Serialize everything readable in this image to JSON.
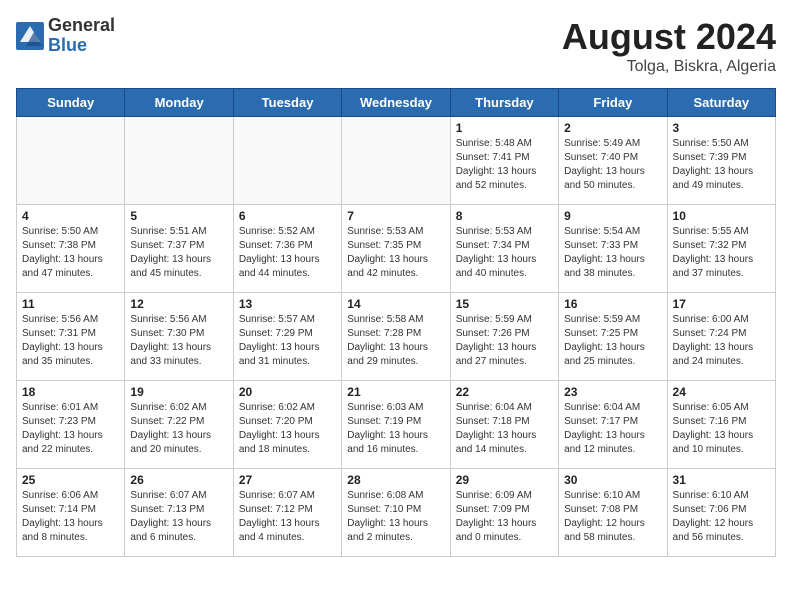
{
  "logo": {
    "general": "General",
    "blue": "Blue"
  },
  "title": {
    "month_year": "August 2024",
    "location": "Tolga, Biskra, Algeria"
  },
  "weekdays": [
    "Sunday",
    "Monday",
    "Tuesday",
    "Wednesday",
    "Thursday",
    "Friday",
    "Saturday"
  ],
  "weeks": [
    [
      {
        "day": "",
        "empty": true
      },
      {
        "day": "",
        "empty": true
      },
      {
        "day": "",
        "empty": true
      },
      {
        "day": "",
        "empty": true
      },
      {
        "day": "1",
        "info": "Sunrise: 5:48 AM\nSunset: 7:41 PM\nDaylight: 13 hours\nand 52 minutes."
      },
      {
        "day": "2",
        "info": "Sunrise: 5:49 AM\nSunset: 7:40 PM\nDaylight: 13 hours\nand 50 minutes."
      },
      {
        "day": "3",
        "info": "Sunrise: 5:50 AM\nSunset: 7:39 PM\nDaylight: 13 hours\nand 49 minutes."
      }
    ],
    [
      {
        "day": "4",
        "info": "Sunrise: 5:50 AM\nSunset: 7:38 PM\nDaylight: 13 hours\nand 47 minutes."
      },
      {
        "day": "5",
        "info": "Sunrise: 5:51 AM\nSunset: 7:37 PM\nDaylight: 13 hours\nand 45 minutes."
      },
      {
        "day": "6",
        "info": "Sunrise: 5:52 AM\nSunset: 7:36 PM\nDaylight: 13 hours\nand 44 minutes."
      },
      {
        "day": "7",
        "info": "Sunrise: 5:53 AM\nSunset: 7:35 PM\nDaylight: 13 hours\nand 42 minutes."
      },
      {
        "day": "8",
        "info": "Sunrise: 5:53 AM\nSunset: 7:34 PM\nDaylight: 13 hours\nand 40 minutes."
      },
      {
        "day": "9",
        "info": "Sunrise: 5:54 AM\nSunset: 7:33 PM\nDaylight: 13 hours\nand 38 minutes."
      },
      {
        "day": "10",
        "info": "Sunrise: 5:55 AM\nSunset: 7:32 PM\nDaylight: 13 hours\nand 37 minutes."
      }
    ],
    [
      {
        "day": "11",
        "info": "Sunrise: 5:56 AM\nSunset: 7:31 PM\nDaylight: 13 hours\nand 35 minutes."
      },
      {
        "day": "12",
        "info": "Sunrise: 5:56 AM\nSunset: 7:30 PM\nDaylight: 13 hours\nand 33 minutes."
      },
      {
        "day": "13",
        "info": "Sunrise: 5:57 AM\nSunset: 7:29 PM\nDaylight: 13 hours\nand 31 minutes."
      },
      {
        "day": "14",
        "info": "Sunrise: 5:58 AM\nSunset: 7:28 PM\nDaylight: 13 hours\nand 29 minutes."
      },
      {
        "day": "15",
        "info": "Sunrise: 5:59 AM\nSunset: 7:26 PM\nDaylight: 13 hours\nand 27 minutes."
      },
      {
        "day": "16",
        "info": "Sunrise: 5:59 AM\nSunset: 7:25 PM\nDaylight: 13 hours\nand 25 minutes."
      },
      {
        "day": "17",
        "info": "Sunrise: 6:00 AM\nSunset: 7:24 PM\nDaylight: 13 hours\nand 24 minutes."
      }
    ],
    [
      {
        "day": "18",
        "info": "Sunrise: 6:01 AM\nSunset: 7:23 PM\nDaylight: 13 hours\nand 22 minutes."
      },
      {
        "day": "19",
        "info": "Sunrise: 6:02 AM\nSunset: 7:22 PM\nDaylight: 13 hours\nand 20 minutes."
      },
      {
        "day": "20",
        "info": "Sunrise: 6:02 AM\nSunset: 7:20 PM\nDaylight: 13 hours\nand 18 minutes."
      },
      {
        "day": "21",
        "info": "Sunrise: 6:03 AM\nSunset: 7:19 PM\nDaylight: 13 hours\nand 16 minutes."
      },
      {
        "day": "22",
        "info": "Sunrise: 6:04 AM\nSunset: 7:18 PM\nDaylight: 13 hours\nand 14 minutes."
      },
      {
        "day": "23",
        "info": "Sunrise: 6:04 AM\nSunset: 7:17 PM\nDaylight: 13 hours\nand 12 minutes."
      },
      {
        "day": "24",
        "info": "Sunrise: 6:05 AM\nSunset: 7:16 PM\nDaylight: 13 hours\nand 10 minutes."
      }
    ],
    [
      {
        "day": "25",
        "info": "Sunrise: 6:06 AM\nSunset: 7:14 PM\nDaylight: 13 hours\nand 8 minutes."
      },
      {
        "day": "26",
        "info": "Sunrise: 6:07 AM\nSunset: 7:13 PM\nDaylight: 13 hours\nand 6 minutes."
      },
      {
        "day": "27",
        "info": "Sunrise: 6:07 AM\nSunset: 7:12 PM\nDaylight: 13 hours\nand 4 minutes."
      },
      {
        "day": "28",
        "info": "Sunrise: 6:08 AM\nSunset: 7:10 PM\nDaylight: 13 hours\nand 2 minutes."
      },
      {
        "day": "29",
        "info": "Sunrise: 6:09 AM\nSunset: 7:09 PM\nDaylight: 13 hours\nand 0 minutes."
      },
      {
        "day": "30",
        "info": "Sunrise: 6:10 AM\nSunset: 7:08 PM\nDaylight: 12 hours\nand 58 minutes."
      },
      {
        "day": "31",
        "info": "Sunrise: 6:10 AM\nSunset: 7:06 PM\nDaylight: 12 hours\nand 56 minutes."
      }
    ]
  ]
}
